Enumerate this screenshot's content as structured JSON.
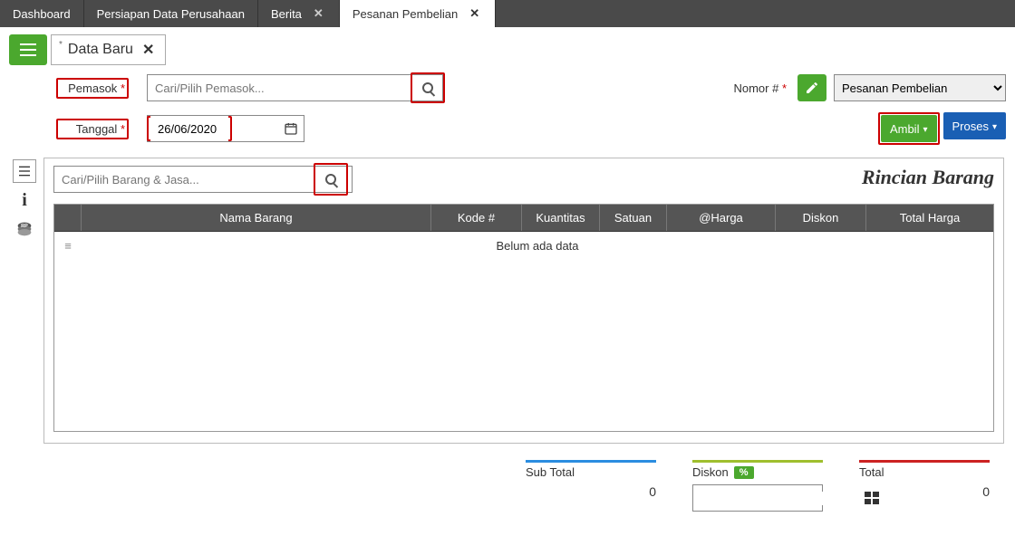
{
  "app_tabs": {
    "dashboard": "Dashboard",
    "persiapan": "Persiapan Data Perusahaan",
    "berita": "Berita",
    "pesanan": "Pesanan Pembelian"
  },
  "data_tab": {
    "label": "Data Baru"
  },
  "form": {
    "pemasok_label": "Pemasok",
    "pemasok_placeholder": "Cari/Pilih Pemasok...",
    "tanggal_label": "Tanggal",
    "tanggal_value": "26/06/2020",
    "nomor_label": "Nomor #",
    "doc_type": "Pesanan Pembelian"
  },
  "buttons": {
    "ambil": "Ambil",
    "proses": "Proses"
  },
  "detail": {
    "item_placeholder": "Cari/Pilih Barang & Jasa...",
    "title": "Rincian Barang",
    "columns": {
      "nama": "Nama Barang",
      "kode": "Kode #",
      "kuantitas": "Kuantitas",
      "satuan": "Satuan",
      "harga": "@Harga",
      "diskon": "Diskon",
      "total": "Total Harga"
    },
    "no_data": "Belum ada data"
  },
  "totals": {
    "sub_label": "Sub Total",
    "sub_value": "0",
    "diskon_label": "Diskon",
    "diskon_pct": "%",
    "total_label": "Total",
    "total_value": "0"
  }
}
